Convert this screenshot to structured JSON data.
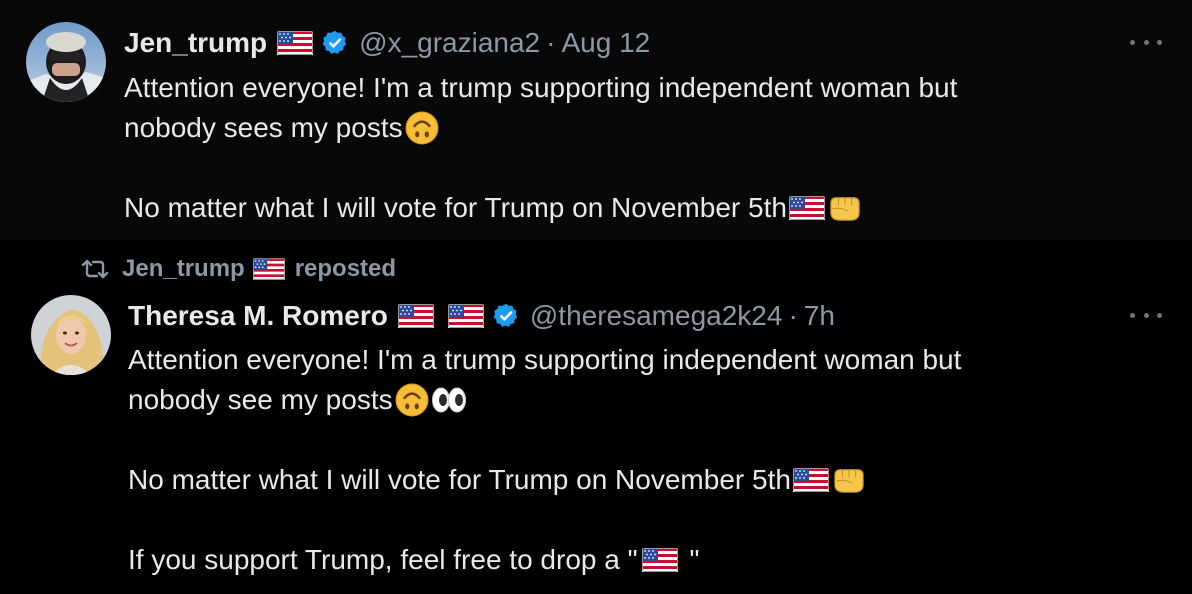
{
  "posts": [
    {
      "display_name": "Jen_trump",
      "handle": "@x_graziana2",
      "separator": "·",
      "time": "Aug 12",
      "lines": [
        "Attention everyone! I'm a trump supporting independent woman but",
        "nobody sees my posts",
        "",
        "No matter what I will vote for Trump on November 5th"
      ]
    },
    {
      "repost_by": "Jen_trump",
      "repost_label": "reposted",
      "display_name": "Theresa M. Romero",
      "handle": "@theresamega2k24",
      "separator": "·",
      "time": "7h",
      "lines": [
        "Attention everyone! I'm a trump supporting independent woman but",
        "nobody see my posts",
        "",
        "No matter what I will vote for Trump on November 5th",
        "",
        "If you support Trump, feel free to drop a \"",
        "\""
      ]
    }
  ],
  "colors": {
    "background": "#000000",
    "post_bg": "#080808",
    "text": "#e7e9ea",
    "muted": "#8b98a5",
    "verified": "#1d9bf0"
  },
  "icons": [
    "us-flag-icon",
    "verified-badge-icon",
    "more-icon",
    "repost-icon",
    "upside-down-face-emoji",
    "eyes-emoji",
    "fist-bump-emoji"
  ]
}
